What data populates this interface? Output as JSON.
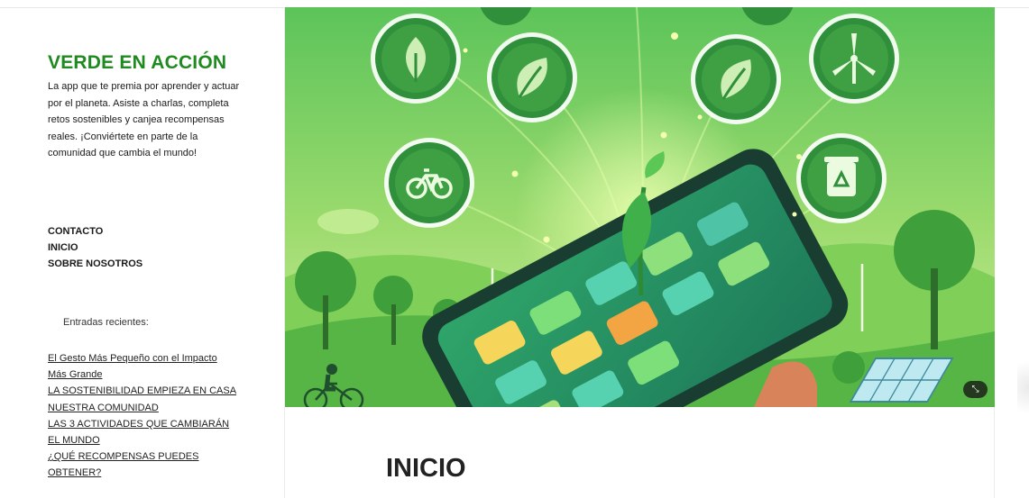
{
  "site": {
    "title": "VERDE EN ACCIÓN",
    "description": "La app que te premia por aprender y actuar por el planeta. Asiste a charlas, completa retos sostenibles y canjea recompensas reales. ¡Conviértete en parte de la comunidad que cambia el mundo!"
  },
  "nav": {
    "items": [
      {
        "label": "CONTACTO"
      },
      {
        "label": "INICIO"
      },
      {
        "label": "SOBRE NOSOTROS"
      }
    ]
  },
  "recent": {
    "heading": "Entradas recientes:",
    "posts": [
      {
        "title": "El Gesto Más Pequeño con el Impacto Más Grande"
      },
      {
        "title": "LA SOSTENIBILIDAD EMPIEZA EN CASA"
      },
      {
        "title": "NUESTRA COMUNIDAD"
      },
      {
        "title": "LAS 3 ACTIVIDADES QUE CAMBIARÁN EL MUNDO"
      },
      {
        "title": "¿QUÉ RECOMPENSAS PUEDES OBTENER?"
      }
    ]
  },
  "main": {
    "page_title": "INICIO",
    "hero_icons": [
      "leaf-icon",
      "leaf-icon",
      "leaf-icon",
      "wind-turbine-icon",
      "bicycle-icon",
      "recycle-bin-icon"
    ],
    "expand_icon": "expand-icon"
  },
  "colors": {
    "accent": "#1f8a1f",
    "hero_green": "#4fb84a",
    "icon_circle": "#2f8f3a"
  }
}
